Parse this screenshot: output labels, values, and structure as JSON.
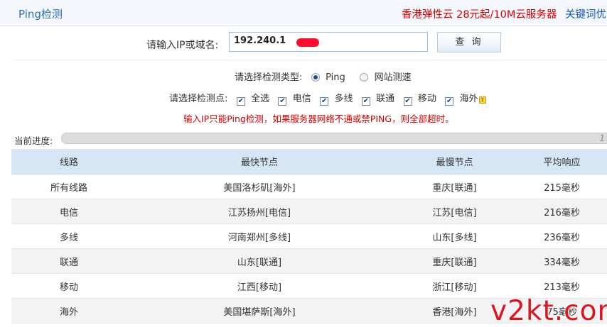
{
  "header": {
    "title": "Ping检测",
    "ad_text": "香港弹性云 28元起/10M云服务器",
    "link_text": "关键词优化"
  },
  "form": {
    "ip_label": "请输入IP或域名:",
    "ip_value": "192.240.1",
    "query_button": "查 询",
    "type_label": "请选择检测类型:",
    "type_options": [
      "Ping",
      "网站测速"
    ],
    "type_selected": "Ping",
    "nodes_label": "请选择检测点:",
    "node_options": [
      "全选",
      "电信",
      "多线",
      "联通",
      "移动",
      "海外"
    ],
    "notice": "输入IP只能Ping检测，如果服务器网络不通或禁PING，则全部超时。"
  },
  "progress": {
    "label": "当前进度:",
    "value_text": "1",
    "fraction": 1.0
  },
  "table": {
    "headers": [
      "线路",
      "最快节点",
      "最慢节点",
      "平均响应"
    ],
    "rows": [
      [
        "所有线路",
        "美国洛杉矶[海外]",
        "重庆[联通]",
        "215毫秒"
      ],
      [
        "电信",
        "江苏扬州[电信]",
        "江苏[电信]",
        "216毫秒"
      ],
      [
        "多线",
        "河南郑州[多线]",
        "山东[多线]",
        "236毫秒"
      ],
      [
        "联通",
        "山东[联通]",
        "重庆[联通]",
        "334毫秒"
      ],
      [
        "移动",
        "江西[移动]",
        "浙江[移动]",
        "213毫秒"
      ],
      [
        "海外",
        "美国堪萨斯[海外]",
        "香港[海外]",
        "75毫秒"
      ]
    ]
  },
  "watermark": "v2kt.com",
  "colors": {
    "accent": "#2a6fb3",
    "ad_red": "#d40000",
    "link_blue": "#1757b5",
    "table_header_bg": "#d6e6f4",
    "row_alt_bg": "#f3f3f3"
  },
  "icons": {
    "radio": "radio-icon",
    "checkbox": "checkbox-icon",
    "help": "help-icon"
  }
}
